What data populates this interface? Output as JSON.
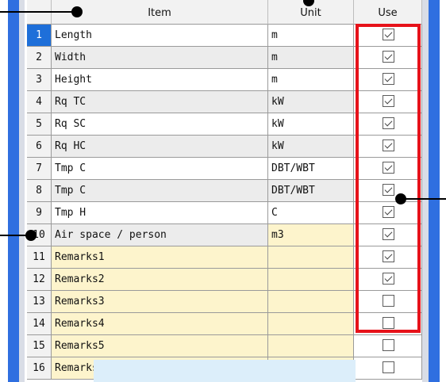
{
  "headers": {
    "item": "Item",
    "unit": "Unit",
    "use": "Use"
  },
  "rows": [
    {
      "num": "1",
      "item": "Length",
      "unit": "m",
      "use": true,
      "selected": true
    },
    {
      "num": "2",
      "item": "Width",
      "unit": "m",
      "use": true
    },
    {
      "num": "3",
      "item": "Height",
      "unit": "m",
      "use": true
    },
    {
      "num": "4",
      "item": "Rq TC",
      "unit": "kW",
      "use": true
    },
    {
      "num": "5",
      "item": "Rq SC",
      "unit": "kW",
      "use": true
    },
    {
      "num": "6",
      "item": "Rq HC",
      "unit": "kW",
      "use": true
    },
    {
      "num": "7",
      "item": "Tmp C",
      "unit": "DBT/WBT",
      "use": true
    },
    {
      "num": "8",
      "item": "Tmp C",
      "unit": "DBT/WBT",
      "use": true
    },
    {
      "num": "9",
      "item": "Tmp H",
      "unit": "C",
      "use": true
    },
    {
      "num": "10",
      "item": "Air space / person",
      "unit": "m3",
      "use": true
    },
    {
      "num": "11",
      "item": "Remarks1",
      "unit": "",
      "use": true
    },
    {
      "num": "12",
      "item": "Remarks2",
      "unit": "",
      "use": true
    },
    {
      "num": "13",
      "item": "Remarks3",
      "unit": "",
      "use": false
    },
    {
      "num": "14",
      "item": "Remarks4",
      "unit": "",
      "use": false
    },
    {
      "num": "15",
      "item": "Remarks5",
      "unit": "",
      "use": false
    },
    {
      "num": "16",
      "item": "Remarks6",
      "unit": "",
      "use": false
    }
  ],
  "colors": {
    "frame": "#2f6fe0",
    "highlight_box": "#e6121a",
    "selected_row_num": "#1e6fd9",
    "remarks_bg": "#fdf4cc"
  }
}
